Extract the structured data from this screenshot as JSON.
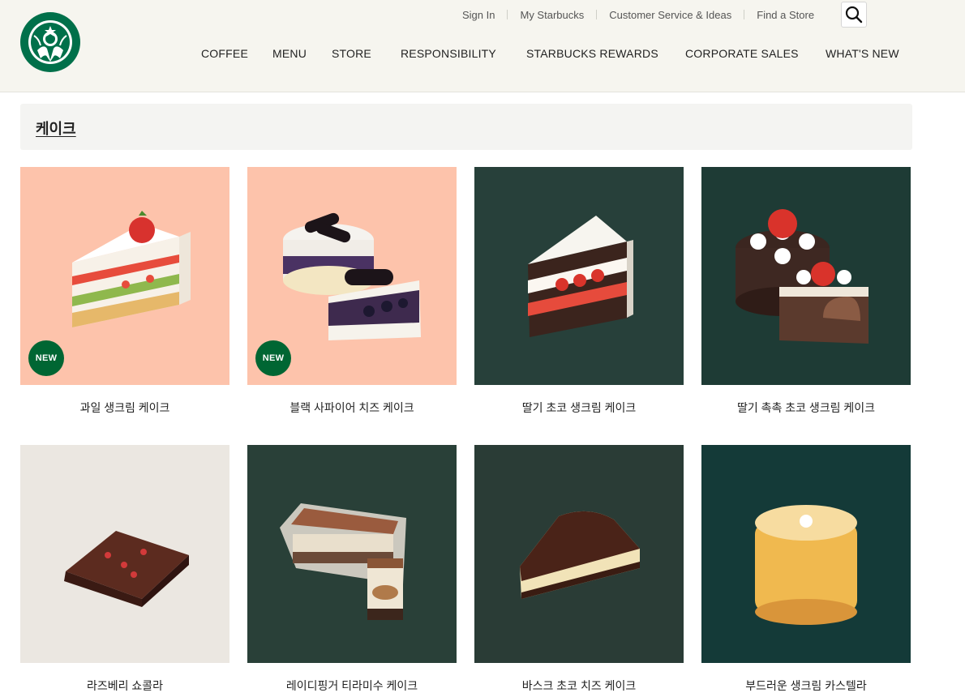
{
  "header": {
    "util_links": [
      "Sign In",
      "My Starbucks",
      "Customer Service & Ideas",
      "Find a Store"
    ],
    "nav": [
      "COFFEE",
      "MENU",
      "STORE",
      "RESPONSIBILITY",
      "STARBUCKS REWARDS",
      "CORPORATE SALES",
      "WHAT'S NEW"
    ]
  },
  "page": {
    "title": "케이크"
  },
  "products": [
    {
      "name": "과일 생크림 케이크",
      "badge": "NEW",
      "bg": "#fdc3ab"
    },
    {
      "name": "블랙 사파이어 치즈 케이크",
      "badge": "NEW",
      "bg": "#fdc3ab"
    },
    {
      "name": "딸기 초코 생크림 케이크",
      "badge": "",
      "bg": "#27403a"
    },
    {
      "name": "딸기 촉촉 초코 생크림 케이크",
      "badge": "",
      "bg": "#1e3b35"
    },
    {
      "name": "라즈베리 쇼콜라",
      "badge": "",
      "bg": "#ebe7e1"
    },
    {
      "name": "레이디핑거 티라미수 케이크",
      "badge": "",
      "bg": "#294038"
    },
    {
      "name": "바스크 초코 치즈 케이크",
      "badge": "",
      "bg": "#2a3c36"
    },
    {
      "name": "부드러운 생크림 카스텔라",
      "badge": "",
      "bg": "#143a38"
    }
  ],
  "colors": {
    "brand_green": "#006633",
    "header_bg": "#f6f5ef"
  },
  "icons": {
    "search": "magnifier-icon",
    "logo": "starbucks-siren-logo"
  }
}
